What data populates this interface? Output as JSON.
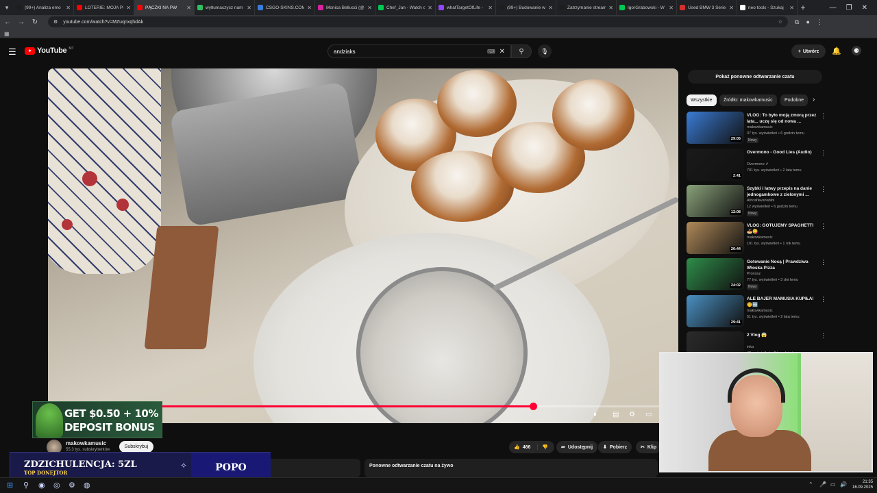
{
  "browser": {
    "tabs": [
      {
        "title": "(99+) Analiza emo",
        "color": "#1e1e1e"
      },
      {
        "title": "LOTERIE: MOJA PER",
        "color": "#ff0000"
      },
      {
        "title": "PĄCZKI NA PW",
        "color": "#ff0000"
      },
      {
        "title": "wytłumaczysz nam",
        "color": "#2fbf5f"
      },
      {
        "title": "CSGO-SKINS.COM",
        "color": "#3b7bd9"
      },
      {
        "title": "Monica Bellucci (@",
        "color": "#d6249f"
      },
      {
        "title": "Chef_Jan - Watch c",
        "color": "#00c853"
      },
      {
        "title": "whatTargetOfLife -",
        "color": "#9146ff"
      },
      {
        "title": "(99+) Budowanie wi",
        "color": "#1e1e1e"
      },
      {
        "title": "Zatrzymanie stream",
        "color": "#1e1e1e"
      },
      {
        "title": "IgorGrabowski - W",
        "color": "#00c853"
      },
      {
        "title": "Used BMW 3 Serie",
        "color": "#d32f2f"
      },
      {
        "title": "neo tools - Szukaj",
        "color": "#ffffff"
      }
    ],
    "active_tab_index": 2,
    "url": "youtube.com/watch?v=MZuqnxqhdAk"
  },
  "header": {
    "logo_text": "YouTube",
    "logo_country": "MT",
    "search_value": "andziaks",
    "create_label": "Utwórz"
  },
  "player": {
    "progress": 0.777,
    "ad_line1": "GET $0.50 + 10%",
    "ad_line2": "DEPOSIT BONUS"
  },
  "channel": {
    "name": "makowkamusic",
    "subscribers": "55,3 tys. subskrybentów",
    "subscribe_label": "Subskrybuj",
    "likes": "466",
    "share_label": "Udostępnij",
    "download_label": "Pobierz",
    "clip_label": "Klip"
  },
  "donation": {
    "main": "ZDZICHULENCJA: 5ZL",
    "sub": "TOP DONEJTOR",
    "right": "POPO"
  },
  "chat": {
    "replay_label": "Pokaż ponowne odtwarzanie czatu",
    "replay_section_label": "Ponowne odtwarzanie czatu na żywo"
  },
  "chips": [
    "Wszystkie",
    "Źródło: makowkamusic",
    "Podobne"
  ],
  "related": [
    {
      "title": "VLOG: To było moją zmorą przez lata... uczę się od nowa ...",
      "channel": "makowkamusic",
      "meta": "37 tys. wyświetleń • 6 godzin temu",
      "badge": "Nowy",
      "duration": "29:05",
      "thumb": "#3a7bd5"
    },
    {
      "title": "Overmono - Good Lies (Audio)",
      "channel": "Overmono ✔",
      "meta": "701 tys. wyświetleń • 2 lata temu",
      "badge": "",
      "duration": "2:41",
      "thumb": "#1a1a1a"
    },
    {
      "title": "Szybki i łatwy przepis na danie jednogamkowe z zielonymi ...",
      "channel": "Africaflavahabibi",
      "meta": "12 wyświetleń • 6 godzin temu",
      "badge": "Nowy",
      "duration": "12:08",
      "thumb": "#8aa27a"
    },
    {
      "title": "VLOG: GOTUJEMY SPAGHETTI 🍝😋",
      "channel": "makowkamusic",
      "meta": "101 tys. wyświetleń • 1 rok temu",
      "badge": "",
      "duration": "20:44",
      "thumb": "#b08a5a"
    },
    {
      "title": "Gotowanie Nocą | Prawdziwa Włoska Pizza",
      "channel": "Pronosz",
      "meta": "77 tys. wyświetleń • 3 dni temu",
      "badge": "Nowy",
      "duration": "24:02",
      "thumb": "#2f8d4a"
    },
    {
      "title": "ALE BAJER MAMUSIA KUPIŁA!🤫🆒",
      "channel": "makowkamusic",
      "meta": "51 tys. wyświetleń • 2 lata temu",
      "badge": "",
      "duration": "29:41",
      "thumb": "#4a90c2"
    },
    {
      "title": "2 Vlog 😱",
      "channel": "inka",
      "meta": "48 wyświetleń • 3 tygodnie temu",
      "badge": "",
      "duration": "",
      "thumb": "#2b2b2b"
    }
  ],
  "taskbar": {
    "time": "21:35",
    "date": "16.09.2025"
  }
}
